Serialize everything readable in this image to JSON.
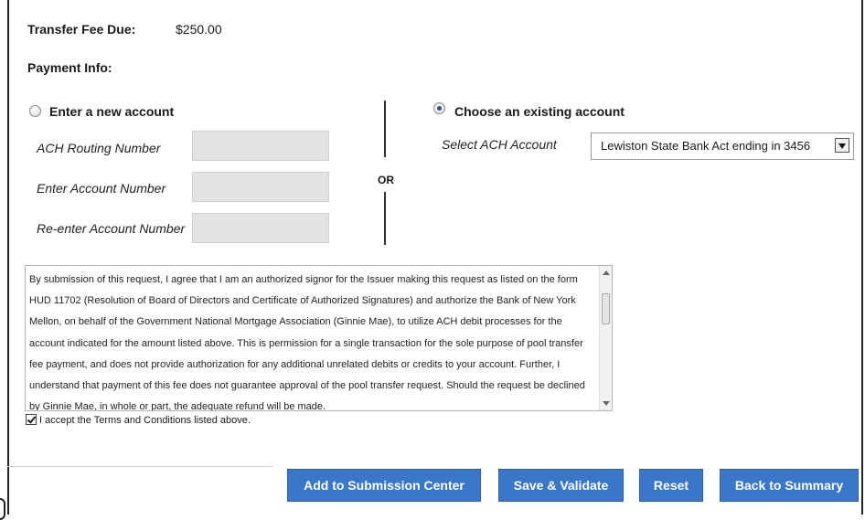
{
  "fee": {
    "label": "Transfer Fee Due:",
    "value": "$250.00"
  },
  "payment": {
    "label": "Payment Info:"
  },
  "new_account": {
    "option_label": "Enter a new account",
    "selected": false,
    "routing_label": "ACH Routing Number",
    "account_label": "Enter Account Number",
    "reenter_label": "Re-enter Account Number",
    "routing_value": "",
    "account_value": "",
    "reenter_value": ""
  },
  "or_label": "OR",
  "existing_account": {
    "option_label": "Choose an existing account",
    "selected": true,
    "select_label": "Select ACH Account",
    "selected_value": "Lewiston State Bank Act ending in 3456"
  },
  "terms": {
    "text": "By submission of this request, I agree that I am an authorized signor for the Issuer making this request as listed on the form HUD 11702 (Resolution of Board of Directors and Certificate of Authorized Signatures) and authorize the Bank of New York Mellon, on behalf of the Government National Mortgage Association (Ginnie Mae), to utilize ACH debit processes for the account indicated for the amount listed above. This is permission for a single transaction for the sole purpose of pool transfer fee payment, and does not provide authorization for any additional unrelated debits or credits to your account. Further, I understand that payment of this fee does not guarantee approval of the pool transfer request. Should the request be declined by Ginnie Mae, in whole or part, the adequate refund will be made.",
    "accept_label": "I accept the Terms and Conditions listed above.",
    "accepted": true
  },
  "buttons": {
    "add": "Add to Submission Center",
    "save": "Save & Validate",
    "reset": "Reset",
    "back": "Back to Summary"
  },
  "colors": {
    "button": "#3a77c9",
    "input": "#e3e3e3"
  }
}
